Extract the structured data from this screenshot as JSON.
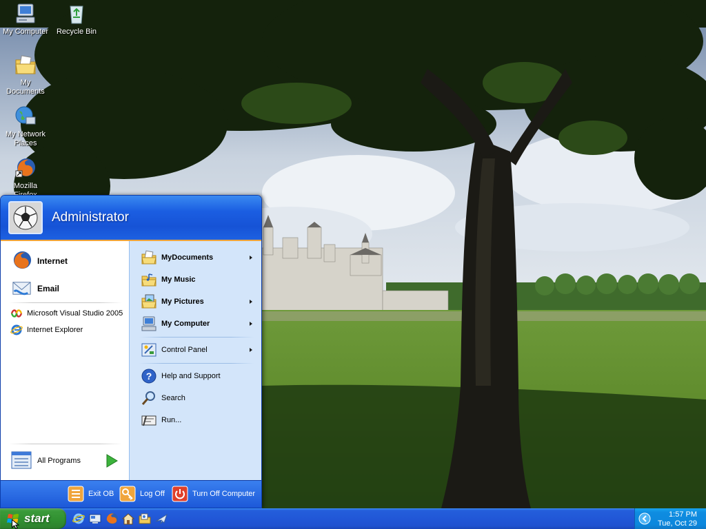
{
  "desktop": {
    "icons": [
      {
        "label": "My Computer",
        "icon": "my-computer-icon"
      },
      {
        "label": "Recycle Bin",
        "icon": "recycle-bin-icon"
      },
      {
        "label": "My Documents",
        "icon": "my-documents-icon"
      },
      {
        "label": "My Network\nPlaces",
        "icon": "network-places-icon"
      },
      {
        "label": "Mozilla Firefox",
        "icon": "firefox-icon"
      }
    ]
  },
  "start_menu": {
    "username": "Administrator",
    "pinned": [
      {
        "label": "Internet",
        "icon": "firefox-icon"
      },
      {
        "label": "Email",
        "icon": "email-icon"
      }
    ],
    "recent": [
      {
        "label": "Microsoft Visual Studio 2005",
        "icon": "visual-studio-icon"
      },
      {
        "label": "Internet Explorer",
        "icon": "internet-explorer-icon"
      }
    ],
    "all_programs_label": "All Programs",
    "right": [
      {
        "label": "MyDocuments",
        "icon": "folder-documents-icon",
        "arrow": true
      },
      {
        "label": "My Music",
        "icon": "folder-music-icon",
        "arrow": false
      },
      {
        "label": "My Pictures",
        "icon": "folder-pictures-icon",
        "arrow": true
      },
      {
        "label": "My Computer",
        "icon": "computer-icon",
        "arrow": true
      },
      {
        "label": "Control Panel",
        "icon": "control-panel-icon",
        "arrow": true
      },
      {
        "label": "Help and Support",
        "icon": "help-icon",
        "arrow": false
      },
      {
        "label": "Search",
        "icon": "search-icon",
        "arrow": false
      },
      {
        "label": "Run...",
        "icon": "run-icon",
        "arrow": false
      }
    ],
    "footer": {
      "exit": "Exit OB",
      "logoff": "Log Off",
      "turnoff": "Turn Off Computer"
    }
  },
  "taskbar": {
    "start_label": "start",
    "quick_launch": [
      "internet-explorer-icon",
      "show-desktop-icon",
      "firefox-icon",
      "home-icon",
      "media-icon",
      "airplane-icon"
    ],
    "clock_time": "1:57 PM",
    "clock_date": "Tue, Oct 29"
  },
  "colors": {
    "taskbar_blue": "#245edb",
    "start_green": "#3a9a3a",
    "tray_blue": "#0f8ce0",
    "menu_header_blue": "#1b5ee2",
    "menu_right_blue": "#d3e5fa",
    "header_orange_line": "#f0a53c"
  }
}
